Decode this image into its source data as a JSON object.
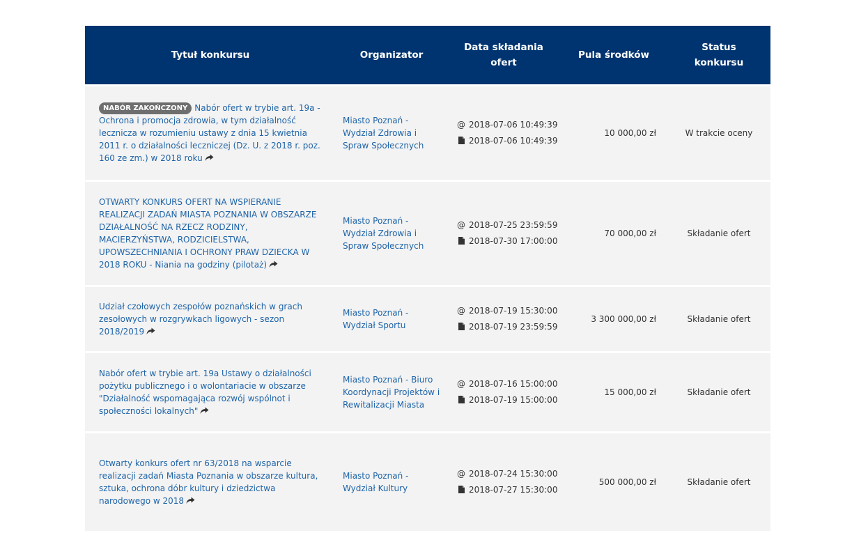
{
  "table": {
    "headers": {
      "title": "Tytuł konkursu",
      "organizer": "Organizator",
      "date": "Data składania ofert",
      "pool": "Pula środków",
      "status": "Status konkursu"
    },
    "rows": [
      {
        "badge": "NABÓR ZAKOŃCZONY",
        "title": "Nabór ofert w trybie art. 19a - Ochrona i promocja zdrowia, w tym działalność lecznicza w rozumieniu ustawy z dnia 15 kwietnia 2011 r. o działalności leczniczej (Dz. U. z 2018 r. poz. 160 ze zm.) w 2018 roku",
        "organizer": "Miasto Poznań - Wydział Zdrowia i Spraw Społecznych",
        "date_at": "2018-07-06 10:49:39",
        "date_doc": "2018-07-06 10:49:39",
        "amount": "10 000,00 zł",
        "status": "W trakcie oceny"
      },
      {
        "badge": "",
        "title": "OTWARTY KONKURS OFERT NA WSPIERANIE REALIZACJI ZADAŃ MIASTA POZNANIA W OBSZARZE DZIAŁALNOŚĆ NA RZECZ RODZINY, MACIERZYŃSTWA, RODZICIELSTWA, UPOWSZECHNIANIA I OCHRONY PRAW DZIECKA W 2018 ROKU - Niania na godziny (pilotaż)",
        "organizer": "Miasto Poznań - Wydział Zdrowia i Spraw Społecznych",
        "date_at": "2018-07-25 23:59:59",
        "date_doc": "2018-07-30 17:00:00",
        "amount": "70 000,00 zł",
        "status": "Składanie ofert"
      },
      {
        "badge": "",
        "title": "Udział czołowych zespołów poznańskich w grach zesołowych w rozgrywkach ligowych - sezon 2018/2019",
        "organizer": "Miasto Poznań - Wydział Sportu",
        "date_at": "2018-07-19 15:30:00",
        "date_doc": "2018-07-19 23:59:59",
        "amount": "3 300 000,00 zł",
        "status": "Składanie ofert"
      },
      {
        "badge": "",
        "title": "Nabór ofert w trybie art. 19a Ustawy o działalności pożytku publicznego i o wolontariacie w obszarze \"Działalność wspomagająca rozwój wspólnot i społeczności lokalnych\"",
        "organizer": "Miasto Poznań - Biuro Koordynacji Projektów i Rewitalizacji Miasta",
        "date_at": "2018-07-16 15:00:00",
        "date_doc": "2018-07-19 15:00:00",
        "amount": "15 000,00 zł",
        "status": "Składanie ofert"
      },
      {
        "badge": "",
        "title": "Otwarty konkurs ofert nr 63/2018 na wsparcie realizacji zadań Miasta Poznania w obszarze kultura, sztuka, ochrona dóbr kultury i dziedzictwa narodowego w 2018",
        "organizer": "Miasto Poznań - Wydział Kultury",
        "date_at": "2018-07-24 15:30:00",
        "date_doc": "2018-07-27 15:30:00",
        "amount": "500 000,00 zł",
        "status": "Składanie ofert"
      }
    ]
  },
  "icons": {
    "share": "share-arrow-icon",
    "at": "@",
    "doc": "document-icon"
  },
  "colors": {
    "header_bg": "#003470",
    "row_bg": "#f3f3f3",
    "link": "#1f64a8",
    "badge_bg": "#6e6e6e"
  }
}
